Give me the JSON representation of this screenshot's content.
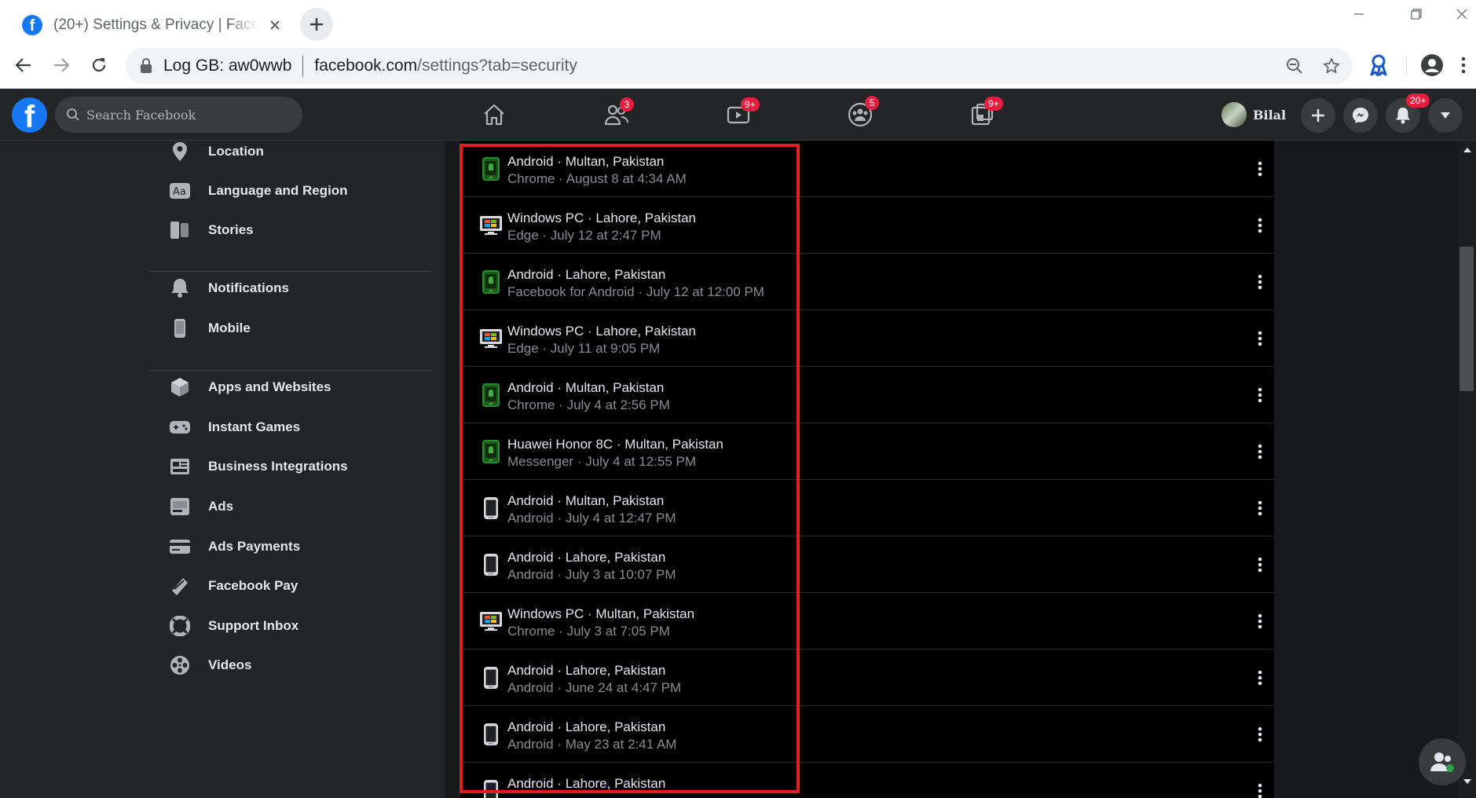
{
  "browser": {
    "tab_title": "(20+) Settings & Privacy | Facebook",
    "site_label": "Log GB: aw0wwb",
    "url_host": "facebook.com",
    "url_rest": "/settings?tab=security"
  },
  "fb_bar": {
    "search_placeholder": "Search Facebook",
    "badges": {
      "friends": "3",
      "watch": "9+",
      "groups": "5",
      "gaming": "9+",
      "notifications": "20+"
    },
    "profile_name": "Bilal"
  },
  "sidebar": {
    "items": [
      {
        "label": "Location",
        "icon": "location-pin-icon"
      },
      {
        "label": "Language and Region",
        "icon": "language-icon"
      },
      {
        "label": "Stories",
        "icon": "stories-icon"
      },
      {
        "label": "Notifications",
        "icon": "bell-icon"
      },
      {
        "label": "Mobile",
        "icon": "mobile-icon"
      },
      {
        "label": "Apps and Websites",
        "icon": "cube-icon"
      },
      {
        "label": "Instant Games",
        "icon": "gamepad-icon"
      },
      {
        "label": "Business Integrations",
        "icon": "business-icon"
      },
      {
        "label": "Ads",
        "icon": "ads-icon"
      },
      {
        "label": "Ads Payments",
        "icon": "credit-card-icon"
      },
      {
        "label": "Facebook Pay",
        "icon": "pay-icon"
      },
      {
        "label": "Support Inbox",
        "icon": "lifebuoy-icon"
      },
      {
        "label": "Videos",
        "icon": "film-reel-icon"
      }
    ]
  },
  "sessions": [
    {
      "device": "Android · Multan, Pakistan",
      "detail": "Chrome · August 8 at 4:34 AM",
      "icon": "android-phone-icon"
    },
    {
      "device": "Windows PC · Lahore, Pakistan",
      "detail": "Edge · July 12 at 2:47 PM",
      "icon": "windows-pc-icon"
    },
    {
      "device": "Android · Lahore, Pakistan",
      "detail": "Facebook for Android · July 12 at 12:00 PM",
      "icon": "android-phone-icon"
    },
    {
      "device": "Windows PC · Lahore, Pakistan",
      "detail": "Edge · July 11 at 9:05 PM",
      "icon": "windows-pc-icon"
    },
    {
      "device": "Android · Multan, Pakistan",
      "detail": "Chrome · July 4 at 2:56 PM",
      "icon": "android-phone-icon"
    },
    {
      "device": "Huawei Honor 8C · Multan, Pakistan",
      "detail": "Messenger · July 4 at 12:55 PM",
      "icon": "android-phone-icon"
    },
    {
      "device": "Android · Multan, Pakistan",
      "detail": "Android · July 4 at 12:47 PM",
      "icon": "mobile-phone-icon"
    },
    {
      "device": "Android · Lahore, Pakistan",
      "detail": "Android · July 3 at 10:07 PM",
      "icon": "mobile-phone-icon"
    },
    {
      "device": "Windows PC · Multan, Pakistan",
      "detail": "Chrome · July 3 at 7:05 PM",
      "icon": "windows-pc-icon"
    },
    {
      "device": "Android · Lahore, Pakistan",
      "detail": "Android · June 24 at 4:47 PM",
      "icon": "mobile-phone-icon"
    },
    {
      "device": "Android · Lahore, Pakistan",
      "detail": "Android · May 23 at 2:41 AM",
      "icon": "mobile-phone-icon"
    },
    {
      "device": "Android · Lahore, Pakistan",
      "detail": "",
      "icon": "mobile-phone-icon"
    }
  ],
  "colors": {
    "fb_blue": "#1877f2",
    "badge_red": "#e41e3f",
    "highlight_red": "#e41e1e",
    "android_green": "#2d8a2d"
  }
}
